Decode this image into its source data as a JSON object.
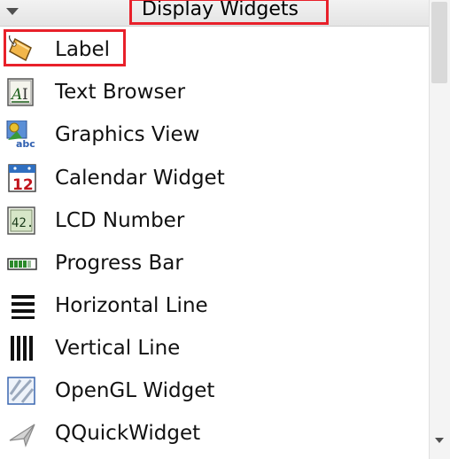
{
  "category": {
    "title": "Display Widgets",
    "expanded": true,
    "highlight_color": "#e8202a"
  },
  "widgets": [
    {
      "label": "Label",
      "icon": "label-tag-icon"
    },
    {
      "label": "Text Browser",
      "icon": "text-browser-icon"
    },
    {
      "label": "Graphics View",
      "icon": "graphics-view-icon"
    },
    {
      "label": "Calendar Widget",
      "icon": "calendar-icon",
      "icon_text": "12"
    },
    {
      "label": "LCD Number",
      "icon": "lcd-number-icon",
      "icon_text": "42."
    },
    {
      "label": "Progress Bar",
      "icon": "progress-bar-icon"
    },
    {
      "label": "Horizontal Line",
      "icon": "horizontal-line-icon"
    },
    {
      "label": "Vertical Line",
      "icon": "vertical-line-icon"
    },
    {
      "label": "OpenGL Widget",
      "icon": "opengl-widget-icon"
    },
    {
      "label": "QQuickWidget",
      "icon": "qquickwidget-icon"
    }
  ]
}
